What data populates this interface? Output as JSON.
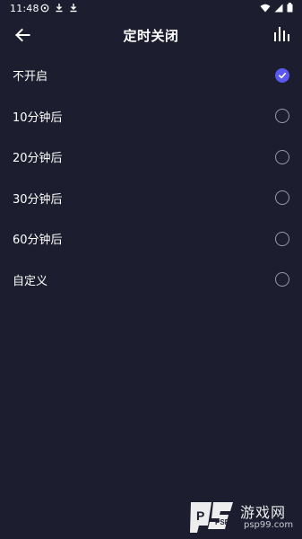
{
  "status_bar": {
    "time": "11:48",
    "left_icons": [
      "assistant-icon",
      "download-icon",
      "download-icon"
    ],
    "right_icons": [
      "wifi-icon",
      "signal-icon",
      "battery-icon"
    ]
  },
  "toolbar": {
    "title": "定时关闭",
    "back_icon": "back-arrow-icon",
    "eq_icon": "equalizer-icon"
  },
  "options": [
    {
      "label": "不开启",
      "selected": true
    },
    {
      "label": "10分钟后",
      "selected": false
    },
    {
      "label": "20分钟后",
      "selected": false
    },
    {
      "label": "30分钟后",
      "selected": false
    },
    {
      "label": "60分钟后",
      "selected": false
    },
    {
      "label": "自定义",
      "selected": false
    }
  ],
  "watermark": {
    "logo_text": "PSP",
    "brand": "游戏网",
    "url": "psp99.com"
  },
  "colors": {
    "background": "#1c1d2e",
    "accent": "#5b58f0",
    "radio_border": "#9a9ba6"
  }
}
